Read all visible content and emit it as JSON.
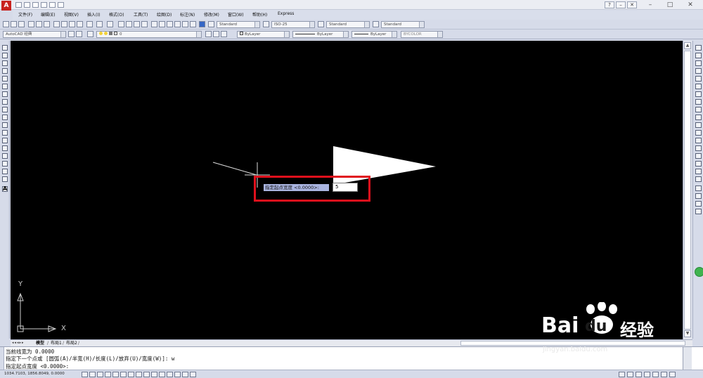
{
  "app": {
    "logo_letter": "A",
    "brand_color": "#c8231e"
  },
  "window_controls": {
    "minimize": "–",
    "restore": "□",
    "close": "✕",
    "help": "?"
  },
  "menubar": {
    "items": [
      "文件(F)",
      "编辑(E)",
      "视图(V)",
      "插入(I)",
      "格式(O)",
      "工具(T)",
      "绘图(D)",
      "标注(N)",
      "修改(M)",
      "窗口(W)",
      "帮助(H)",
      "Express"
    ]
  },
  "toolbar_styles": {
    "text_style": "Standard",
    "dim_style": "ISO-25",
    "table_style": "Standard",
    "mleader_style": "Standard"
  },
  "toolbar_layers": {
    "workspace": "AutoCAD 经典",
    "layer": "0",
    "color": "ByLayer",
    "linetype": "ByLayer",
    "lineweight": "ByLayer",
    "plotstyle": "BYCOLOR"
  },
  "canvas": {
    "background": "#000000"
  },
  "ucs": {
    "x_label": "X",
    "y_label": "Y"
  },
  "dynamic_input": {
    "prompt": "指定起点宽度 <0.0000>:",
    "value": "5"
  },
  "layout_tabs": {
    "model": "模型",
    "layout1": "布局1",
    "layout2": "布局2"
  },
  "command_window": {
    "lines": [
      "当前线宽为 0.0000",
      "指定下一个点或 [圆弧(A)/半宽(H)/长度(L)/放弃(U)/宽度(W)]: w",
      "指定起点宽度 <0.0000>:"
    ]
  },
  "statusbar": {
    "coordinates": "1034.7103,  1856.8049,  0.0000"
  },
  "watermark": {
    "brand": "Bai",
    "brand2": "du",
    "cn": "经验",
    "url": "jingyan.baidu.com"
  }
}
